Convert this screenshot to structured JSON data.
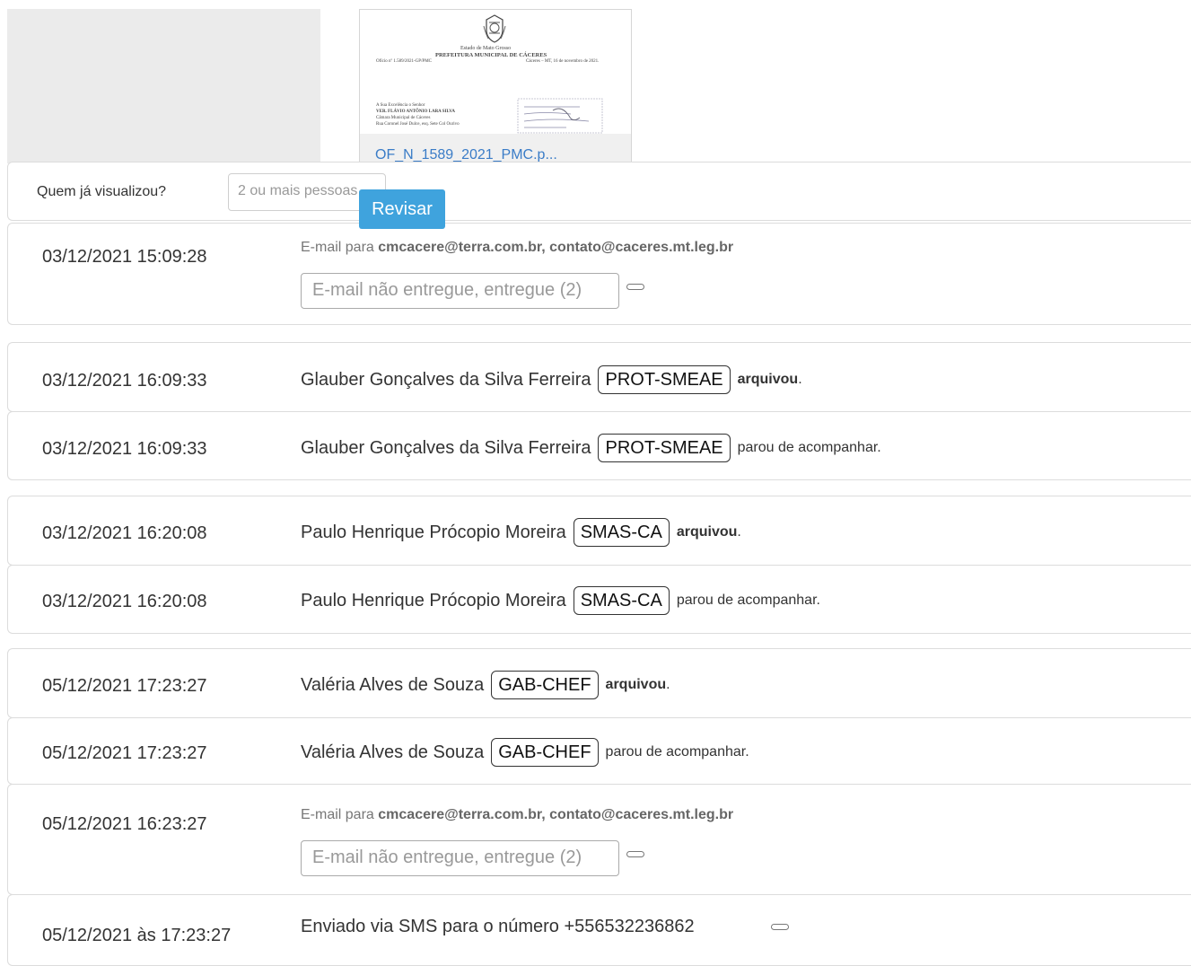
{
  "attachment": {
    "file_name": "OF_N_1589_2021_PMC.p...",
    "preview": {
      "state": "Estado de Mato Grosso",
      "city_hall": "PREFEITURA MUNICIPAL DE CÁCERES",
      "ref": "Ofício nº 1.589/2021-GP/PMC",
      "date_place": "Cáceres – MT, 16 de novembro de 2021.",
      "addr1": "A Sua Excelência o Senhor",
      "addr2": "VER. FLÁVIO ANTÔNIO LARA SILVA",
      "addr3": "Câmara Municipal de Cáceres",
      "addr4": "Rua Coronel José Dulce, esq. Sete Col Ourivo"
    }
  },
  "viewers": {
    "label": "Quem já visualizou?",
    "value": "2 ou mais pessoas"
  },
  "review_button": "Revisar",
  "events": [
    {
      "time": "03/12/2021 15:09:28",
      "mail_prefix": "E-mail para",
      "mail_to": "cmcacere@terra.com.br, contato@caceres.mt.leg.br",
      "status": "E-mail não entregue, entregue (2)"
    },
    {
      "time": "03/12/2021 16:09:33",
      "person": "Glauber Gonçalves da Silva Ferreira",
      "unit": "PROT-SMEAE",
      "action": "arquivou",
      "suffix": "."
    },
    {
      "time": "03/12/2021 16:09:33",
      "person": "Glauber Gonçalves da Silva Ferreira",
      "unit": "PROT-SMEAE",
      "action": "parou de acompanhar."
    },
    {
      "time": "03/12/2021 16:20:08",
      "person": "Paulo Henrique Prócopio Moreira",
      "unit": "SMAS-CA",
      "action": "arquivou",
      "suffix": "."
    },
    {
      "time": "03/12/2021 16:20:08",
      "person": "Paulo Henrique Prócopio Moreira",
      "unit": "SMAS-CA",
      "action": "parou de acompanhar."
    },
    {
      "time": "05/12/2021 17:23:27",
      "person": "Valéria Alves de Souza",
      "unit": "GAB-CHEF",
      "action": "arquivou",
      "suffix": "."
    },
    {
      "time": "05/12/2021 17:23:27",
      "person": "Valéria Alves de Souza",
      "unit": "GAB-CHEF",
      "action": "parou de acompanhar."
    },
    {
      "time": "05/12/2021 16:23:27",
      "mail_prefix": "E-mail para",
      "mail_to": "cmcacere@terra.com.br, contato@caceres.mt.leg.br",
      "status": "E-mail não entregue, entregue (2)"
    },
    {
      "time": "05/12/2021 às 17:23:27",
      "sms": "Enviado via SMS para o número +556532236862"
    }
  ],
  "icons": {
    "toggle": "toggle-icon",
    "seal": "coat-of-arms-icon"
  }
}
